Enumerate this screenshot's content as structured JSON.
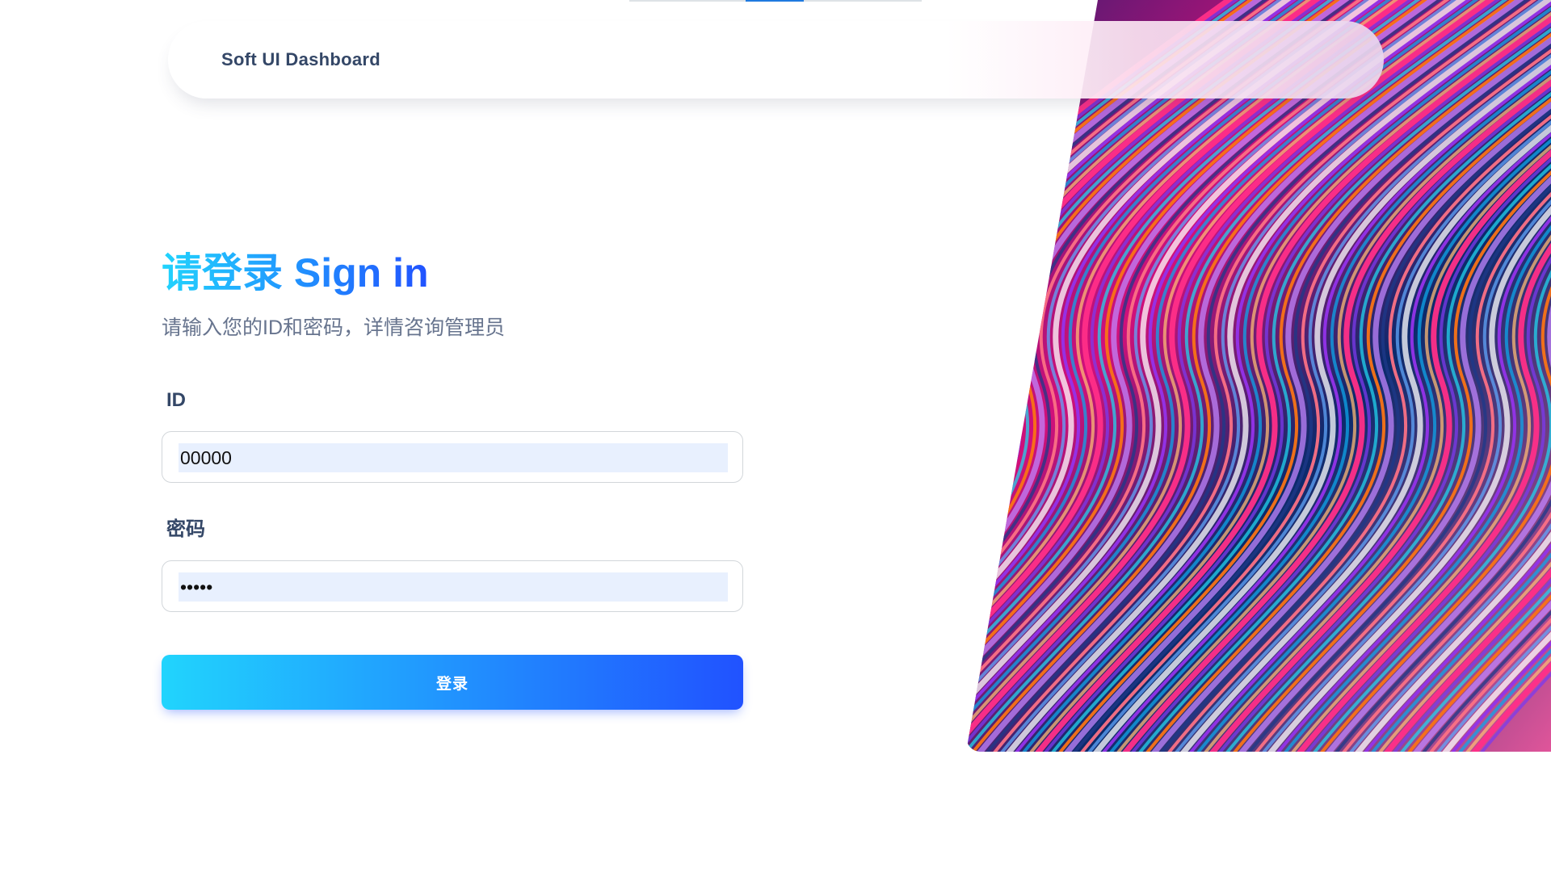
{
  "colors": {
    "accent_start": "#21d4fd",
    "accent_end": "#2152ff",
    "text_dark": "#344767",
    "text_muted": "#67748e",
    "input_fill": "#e8f0fe"
  },
  "page_progress": {
    "fraction": 0.2
  },
  "navbar": {
    "brand": "Soft UI Dashboard"
  },
  "login": {
    "title": "请登录 Sign in",
    "subtitle": "请输入您的ID和密码，详情咨询管理员",
    "id_label": "ID",
    "id_value": "00000",
    "password_label": "密码",
    "password_value": "•••••",
    "submit_label": "登录"
  },
  "hero": {
    "icon": "abstract-waves-image"
  }
}
